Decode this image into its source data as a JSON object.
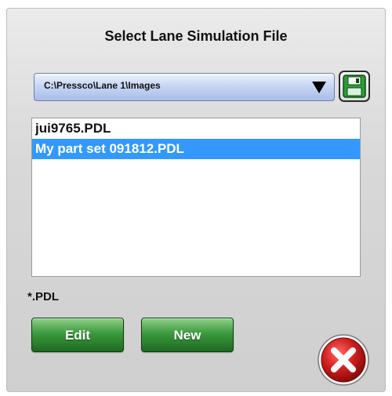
{
  "dialog": {
    "title": "Select Lane Simulation File"
  },
  "path_dropdown": {
    "selected": "C:\\Pressco\\Lane 1\\Images"
  },
  "file_list": {
    "items": [
      {
        "name": "jui9765.PDL",
        "selected": false
      },
      {
        "name": "My part set 091812.PDL",
        "selected": true
      }
    ]
  },
  "filter": {
    "pattern": "*.PDL"
  },
  "buttons": {
    "edit_label": "Edit",
    "new_label": "New"
  },
  "icons": {
    "save": "floppy-disk-icon",
    "dropdown": "dropdown-arrow-icon",
    "close": "close-x-icon"
  },
  "colors": {
    "selection": "#3399ff",
    "button_green": "#2f8a33",
    "close_red": "#cc1f1f",
    "save_icon_green": "#2e9b3a"
  }
}
